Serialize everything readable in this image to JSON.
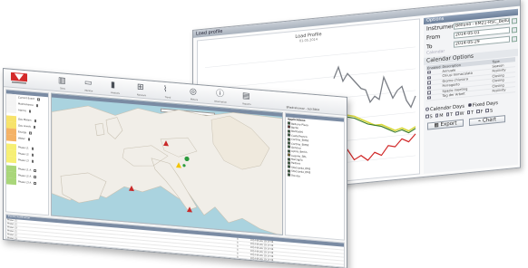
{
  "back_window": {
    "title": "Load profile",
    "chart_title": "Load Profile",
    "chart_subtitle": "01.05.2014",
    "options_title": "Options",
    "fields": [
      {
        "label": "Instrument:",
        "value": "Belluno - EM21-RSC_Belluno"
      },
      {
        "label": "From",
        "value": "2014-05-01"
      },
      {
        "label": "To",
        "value": "2014-05-29"
      }
    ],
    "calendar_label": "Calendar",
    "calendar_options_title": "Calendar Options",
    "table_headers": [
      "Enabled",
      "Description",
      "Type"
    ],
    "table_rows": [
      {
        "desc": "Annuale",
        "type": "Season"
      },
      {
        "desc": "Chiusi Immacolata",
        "type": "Festivity"
      },
      {
        "desc": "Giorno chiusura",
        "type": "Closing"
      },
      {
        "desc": "Ferragosto",
        "type": "Closing"
      },
      {
        "desc": "Spazio meeting",
        "type": "Closing"
      },
      {
        "desc": "Tag der Arbeit",
        "type": "Festivity"
      }
    ],
    "calendar_days_label": "Calendar Days",
    "fixed_days_label": "Fixed Days",
    "weekdays": [
      "S",
      "M",
      "T",
      "W",
      "T",
      "F",
      "S"
    ],
    "export_label": "Export",
    "chart_label": "Chart"
  },
  "front_window": {
    "toolbar": [
      {
        "icon": "building-icon",
        "label": "Sites"
      },
      {
        "icon": "monitor-icon",
        "label": "Monitor"
      },
      {
        "icon": "bar-chart-icon",
        "label": "Analysis"
      },
      {
        "icon": "network-icon",
        "label": "Network"
      },
      {
        "icon": "line-chart-icon",
        "label": "Trend"
      },
      {
        "icon": "gauge-icon",
        "label": "Meters"
      },
      {
        "icon": "info-icon",
        "label": "Information"
      },
      {
        "icon": "document-icon",
        "label": "Reports"
      }
    ],
    "user_text": "Bhadrakumar - bch7864",
    "left_rows": [
      {
        "label": "Current Event",
        "color": "#f4f4f4"
      },
      {
        "label": "Maintenance",
        "color": "#f4f4f4"
      },
      {
        "label": "Alarms",
        "color": "#f4f4f4"
      },
      {
        "label": "Gas Meters",
        "color": "#f7e36b"
      },
      {
        "label": "Gas Levels",
        "color": "#f7e36b"
      },
      {
        "label": "Energy",
        "color": "#f4b266"
      },
      {
        "label": "Water",
        "color": "#f4b266"
      },
      {
        "label": "Phase L1",
        "color": "#f6ef74"
      },
      {
        "label": "Phase L2",
        "color": "#f6ef74"
      },
      {
        "label": "Phase L3",
        "color": "#f6ef74"
      },
      {
        "label": "Phase L1 A",
        "color": "#a9d67a"
      },
      {
        "label": "Phase L2 A",
        "color": "#a9d67a"
      },
      {
        "label": "Phase L3 A",
        "color": "#a9d67a"
      }
    ],
    "legend_title": "Applications",
    "legend_items": [
      {
        "label": "Belluno Plaza",
        "color": "#2b9b3d"
      },
      {
        "label": "Berlin",
        "color": "#c92a2a"
      },
      {
        "label": "Bonfadini",
        "color": "#2b9b3d"
      },
      {
        "label": "Castelfranco",
        "color": "#2b9b3d"
      },
      {
        "label": "Cortina_EMS2",
        "color": "#2b9b3d"
      },
      {
        "label": "Cortina_EMS3",
        "color": "#2b9b3d"
      },
      {
        "label": "Genova",
        "color": "#2b9b3d"
      },
      {
        "label": "Lipsia_Berlin",
        "color": "#2b9b3d"
      },
      {
        "label": "Lugano_SRL",
        "color": "#f2c400"
      },
      {
        "label": "Marsiglia",
        "color": "#2b9b3d"
      },
      {
        "label": "Padova",
        "color": "#2b9b3d"
      },
      {
        "label": "Stoccarda_EM2",
        "color": "#2b9b3d"
      },
      {
        "label": "Stoccarda_EM3",
        "color": "#2b9b3d"
      },
      {
        "label": "Treviso",
        "color": "#2b9b3d"
      }
    ],
    "bottom_title": "Events notification",
    "bottom_rows": [
      {
        "name": "Phase L1",
        "level": "3",
        "date": "2014-05-06 10:17:36"
      },
      {
        "name": "Phase L2",
        "level": "3",
        "date": "2014-05-06 10:17:36"
      },
      {
        "name": "Phase L3",
        "level": "3",
        "date": "2014-05-06 10:17:36"
      },
      {
        "name": "Phase L1",
        "level": "3",
        "date": "2014-05-06 10:17:36"
      },
      {
        "name": "Phase L2",
        "level": "3",
        "date": "2014-05-06 10:17:36"
      },
      {
        "name": "Phase L3",
        "level": "3",
        "date": "2014-05-06 10:17:36"
      }
    ]
  },
  "colors": {
    "brand_red": "#d42a2a",
    "header_blue": "#7a8ba3",
    "sea": "#aad3df",
    "land": "#f1eee8",
    "line_gray": "#7b7f86",
    "line_yellow": "#d8d83a",
    "line_green": "#3a7a2a",
    "line_red": "#d02626"
  }
}
